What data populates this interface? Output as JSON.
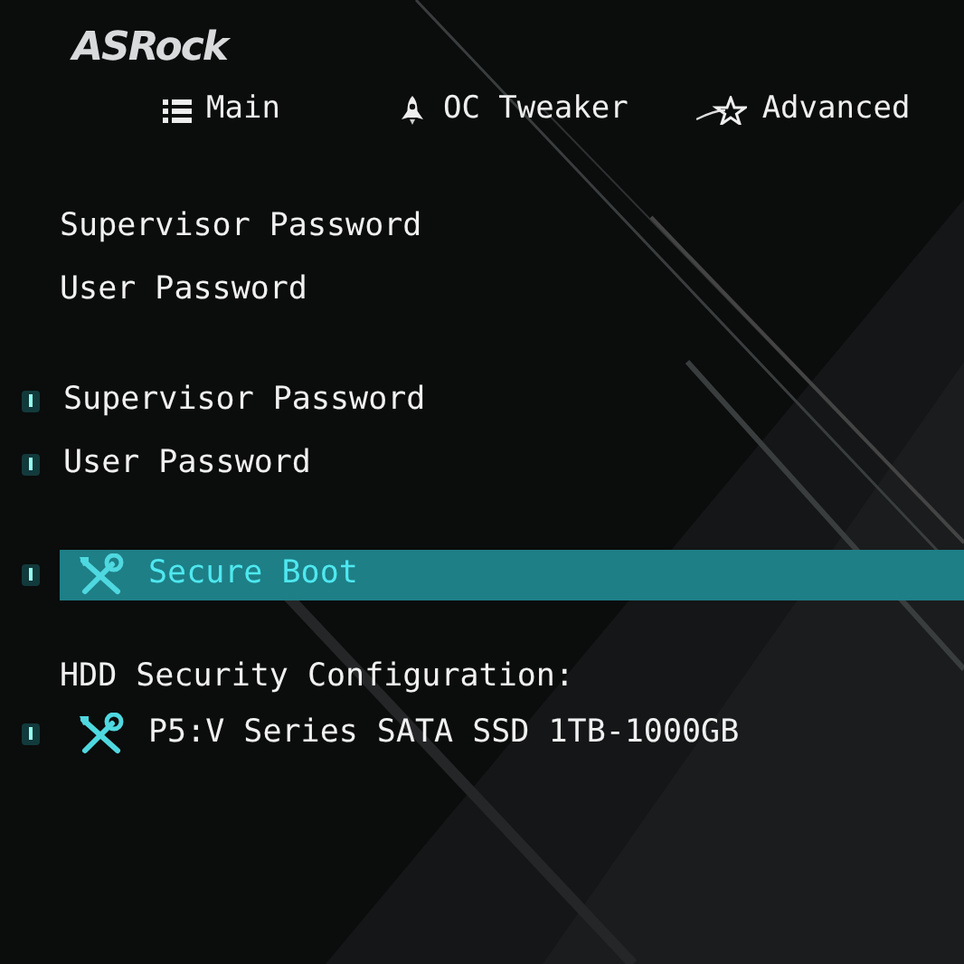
{
  "logo": {
    "text": "ASRock"
  },
  "tabs": [
    {
      "label": "Main",
      "kind": "list",
      "selected": false
    },
    {
      "label": "OC Tweaker",
      "kind": "rocket",
      "selected": false
    },
    {
      "label": "Advanced",
      "kind": "star",
      "selected": false
    }
  ],
  "sections": [
    {
      "items": [
        {
          "kind": "info",
          "label": "Supervisor Password",
          "selected": false
        },
        {
          "kind": "info",
          "label": "User Password",
          "selected": false
        }
      ]
    },
    {
      "items": [
        {
          "kind": "setting",
          "label": "Supervisor Password",
          "selected": false
        },
        {
          "kind": "setting",
          "label": "User Password",
          "selected": false
        }
      ]
    },
    {
      "items": [
        {
          "kind": "submenu",
          "label": "Secure Boot",
          "selected": true
        }
      ]
    },
    {
      "items": [
        {
          "kind": "header",
          "label": "HDD Security Configuration:",
          "selected": false
        },
        {
          "kind": "submenu",
          "label": "P5:V Series SATA SSD 1TB-1000GB",
          "selected": false
        }
      ]
    }
  ]
}
